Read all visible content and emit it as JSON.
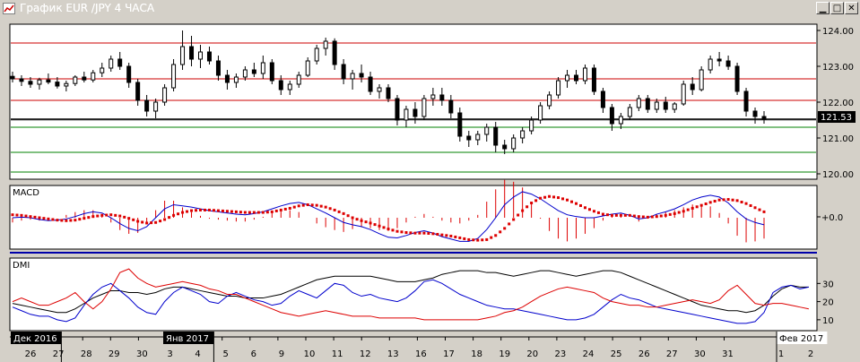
{
  "window": {
    "title": "График EUR /JPY  4 ЧАСА",
    "buttons": [
      "minimize",
      "maximize",
      "close"
    ]
  },
  "chart_data": [
    {
      "panel": "price",
      "type": "candlestick",
      "y_ticks": [
        "124.00",
        "123.00",
        "122.00",
        "121.00",
        "120.00"
      ],
      "ylim": [
        119.9,
        124.1
      ],
      "last_price_label": "121.53",
      "last_price": 121.53,
      "horizontal_lines": {
        "red": [
          123.65,
          122.65,
          122.05
        ],
        "black": [
          121.53
        ],
        "green": [
          121.3,
          120.6,
          120.05
        ]
      },
      "ohlc": [
        [
          122.72,
          122.85,
          122.55,
          122.65
        ],
        [
          122.65,
          122.75,
          122.45,
          122.58
        ],
        [
          122.58,
          122.7,
          122.4,
          122.5
        ],
        [
          122.5,
          122.68,
          122.35,
          122.62
        ],
        [
          122.62,
          122.8,
          122.5,
          122.56
        ],
        [
          122.56,
          122.7,
          122.38,
          122.45
        ],
        [
          122.45,
          122.6,
          122.3,
          122.52
        ],
        [
          122.52,
          122.75,
          122.45,
          122.7
        ],
        [
          122.7,
          122.85,
          122.55,
          122.62
        ],
        [
          122.62,
          122.9,
          122.55,
          122.82
        ],
        [
          122.82,
          123.1,
          122.7,
          122.95
        ],
        [
          122.95,
          123.3,
          122.85,
          123.2
        ],
        [
          123.2,
          123.4,
          122.9,
          123.0
        ],
        [
          123.0,
          123.1,
          122.4,
          122.55
        ],
        [
          122.55,
          122.65,
          121.9,
          122.05
        ],
        [
          122.05,
          122.2,
          121.6,
          121.75
        ],
        [
          121.75,
          122.1,
          121.55,
          122.0
        ],
        [
          122.0,
          122.5,
          121.9,
          122.4
        ],
        [
          122.4,
          123.2,
          122.3,
          123.05
        ],
        [
          123.05,
          124.0,
          122.9,
          123.55
        ],
        [
          123.55,
          123.85,
          123.0,
          123.2
        ],
        [
          123.2,
          123.6,
          122.95,
          123.4
        ],
        [
          123.4,
          123.55,
          123.05,
          123.15
        ],
        [
          123.15,
          123.3,
          122.6,
          122.75
        ],
        [
          122.75,
          122.9,
          122.35,
          122.55
        ],
        [
          122.55,
          122.8,
          122.4,
          122.7
        ],
        [
          122.7,
          123.0,
          122.6,
          122.9
        ],
        [
          122.9,
          123.1,
          122.7,
          122.8
        ],
        [
          122.8,
          123.3,
          122.65,
          123.1
        ],
        [
          123.1,
          123.2,
          122.5,
          122.6
        ],
        [
          122.6,
          122.75,
          122.2,
          122.35
        ],
        [
          122.35,
          122.6,
          122.2,
          122.5
        ],
        [
          122.5,
          122.85,
          122.4,
          122.75
        ],
        [
          122.75,
          123.25,
          122.7,
          123.15
        ],
        [
          123.15,
          123.6,
          123.05,
          123.5
        ],
        [
          123.5,
          123.8,
          123.3,
          123.7
        ],
        [
          123.7,
          123.78,
          122.9,
          123.05
        ],
        [
          123.05,
          123.2,
          122.5,
          122.65
        ],
        [
          122.65,
          122.9,
          122.35,
          122.8
        ],
        [
          122.8,
          123.05,
          122.55,
          122.7
        ],
        [
          122.7,
          122.85,
          122.2,
          122.3
        ],
        [
          122.3,
          122.5,
          122.1,
          122.4
        ],
        [
          122.4,
          122.5,
          122.0,
          122.1
        ],
        [
          122.1,
          122.2,
          121.35,
          121.5
        ],
        [
          121.5,
          121.9,
          121.3,
          121.8
        ],
        [
          121.8,
          122.0,
          121.4,
          121.6
        ],
        [
          121.6,
          122.2,
          121.5,
          122.1
        ],
        [
          122.1,
          122.4,
          121.9,
          122.2
        ],
        [
          122.2,
          122.4,
          121.9,
          122.05
        ],
        [
          122.05,
          122.2,
          121.55,
          121.7
        ],
        [
          121.7,
          121.85,
          120.9,
          121.05
        ],
        [
          121.05,
          121.2,
          120.75,
          120.95
        ],
        [
          120.95,
          121.2,
          120.8,
          121.1
        ],
        [
          121.1,
          121.4,
          120.9,
          121.3
        ],
        [
          121.3,
          121.45,
          120.6,
          120.8
        ],
        [
          120.8,
          120.95,
          120.55,
          120.7
        ],
        [
          120.7,
          121.1,
          120.6,
          121.0
        ],
        [
          121.0,
          121.3,
          120.85,
          121.2
        ],
        [
          121.2,
          121.6,
          121.1,
          121.5
        ],
        [
          121.5,
          122.0,
          121.4,
          121.9
        ],
        [
          121.9,
          122.3,
          121.8,
          122.2
        ],
        [
          122.2,
          122.7,
          122.1,
          122.6
        ],
        [
          122.6,
          122.9,
          122.4,
          122.75
        ],
        [
          122.75,
          122.9,
          122.5,
          122.6
        ],
        [
          122.6,
          123.05,
          122.5,
          122.95
        ],
        [
          122.95,
          123.05,
          122.2,
          122.3
        ],
        [
          122.3,
          122.4,
          121.7,
          121.85
        ],
        [
          121.85,
          121.95,
          121.2,
          121.4
        ],
        [
          121.4,
          121.7,
          121.25,
          121.6
        ],
        [
          121.6,
          121.95,
          121.5,
          121.85
        ],
        [
          121.85,
          122.2,
          121.75,
          122.1
        ],
        [
          122.1,
          122.2,
          121.7,
          121.8
        ],
        [
          121.8,
          122.1,
          121.7,
          122.0
        ],
        [
          122.0,
          122.15,
          121.7,
          121.8
        ],
        [
          121.8,
          122.0,
          121.7,
          121.95
        ],
        [
          121.95,
          122.6,
          121.9,
          122.5
        ],
        [
          122.5,
          122.7,
          122.2,
          122.35
        ],
        [
          122.35,
          123.0,
          122.3,
          122.9
        ],
        [
          122.9,
          123.3,
          122.8,
          123.2
        ],
        [
          123.2,
          123.4,
          123.0,
          123.15
        ],
        [
          123.15,
          123.3,
          122.9,
          123.0
        ],
        [
          123.0,
          123.1,
          122.2,
          122.3
        ],
        [
          122.3,
          122.4,
          121.6,
          121.75
        ],
        [
          121.75,
          121.85,
          121.4,
          121.6
        ],
        [
          121.6,
          121.75,
          121.4,
          121.53
        ]
      ]
    },
    {
      "panel": "macd",
      "type": "line+histogram",
      "label": "MACD",
      "zero_label": "+0.0",
      "ylim": [
        -0.5,
        0.5
      ],
      "macd": [
        0.0,
        0.01,
        0.0,
        -0.03,
        -0.05,
        -0.04,
        -0.02,
        0.02,
        0.07,
        0.1,
        0.08,
        0.0,
        -0.1,
        -0.18,
        -0.22,
        -0.15,
        0.0,
        0.15,
        0.22,
        0.2,
        0.18,
        0.15,
        0.12,
        0.1,
        0.08,
        0.06,
        0.05,
        0.07,
        0.1,
        0.15,
        0.2,
        0.24,
        0.26,
        0.22,
        0.15,
        0.08,
        0.0,
        -0.08,
        -0.12,
        -0.15,
        -0.2,
        -0.27,
        -0.33,
        -0.34,
        -0.3,
        -0.25,
        -0.22,
        -0.26,
        -0.32,
        -0.36,
        -0.4,
        -0.4,
        -0.35,
        -0.2,
        0.0,
        0.22,
        0.35,
        0.44,
        0.4,
        0.32,
        0.22,
        0.12,
        0.05,
        0.02,
        0.0,
        0.0,
        0.03,
        0.06,
        0.08,
        0.04,
        -0.02,
        0.0,
        0.06,
        0.1,
        0.15,
        0.22,
        0.3,
        0.35,
        0.38,
        0.35,
        0.25,
        0.1,
        -0.02,
        -0.08,
        -0.12
      ],
      "signal": [
        0.05,
        0.04,
        0.02,
        0.0,
        -0.02,
        -0.04,
        -0.05,
        -0.04,
        -0.01,
        0.02,
        0.04,
        0.05,
        0.03,
        -0.01,
        -0.06,
        -0.09,
        -0.08,
        -0.03,
        0.04,
        0.09,
        0.12,
        0.13,
        0.13,
        0.12,
        0.11,
        0.1,
        0.09,
        0.09,
        0.09,
        0.1,
        0.13,
        0.16,
        0.2,
        0.22,
        0.21,
        0.18,
        0.13,
        0.07,
        0.0,
        -0.05,
        -0.09,
        -0.14,
        -0.19,
        -0.23,
        -0.25,
        -0.26,
        -0.26,
        -0.27,
        -0.29,
        -0.31,
        -0.34,
        -0.37,
        -0.38,
        -0.37,
        -0.3,
        -0.18,
        -0.03,
        0.12,
        0.25,
        0.33,
        0.36,
        0.34,
        0.3,
        0.24,
        0.17,
        0.11,
        0.06,
        0.04,
        0.04,
        0.04,
        0.02,
        0.01,
        0.02,
        0.04,
        0.07,
        0.11,
        0.16,
        0.21,
        0.26,
        0.3,
        0.31,
        0.29,
        0.24,
        0.17,
        0.1
      ]
    },
    {
      "panel": "dmi",
      "type": "line",
      "label": "DMI",
      "y_ticks": [
        "30",
        "20",
        "10"
      ],
      "ylim": [
        5,
        43
      ],
      "series": [
        {
          "name": "",
          "color": "#000000",
          "values": [
            19,
            18,
            17,
            16,
            15,
            14,
            14,
            16,
            19,
            22,
            24,
            26,
            26,
            25,
            25,
            24,
            25,
            27,
            28,
            28,
            27,
            26,
            25,
            24,
            23,
            23,
            22,
            22,
            22,
            23,
            24,
            26,
            28,
            30,
            32,
            33,
            34,
            34,
            34,
            34,
            34,
            33,
            32,
            31,
            31,
            31,
            32,
            33,
            35,
            36,
            37,
            37,
            37,
            36,
            36,
            35,
            34,
            35,
            36,
            37,
            37,
            36,
            35,
            34,
            35,
            36,
            37,
            37,
            36,
            34,
            32,
            30,
            28,
            26,
            24,
            22,
            20,
            18,
            17,
            16,
            15,
            15,
            14,
            15,
            18,
            23,
            27,
            29,
            28,
            28
          ]
        },
        {
          "name": "",
          "color": "#0000cc",
          "values": [
            17,
            15,
            13,
            12,
            12,
            10,
            9,
            11,
            18,
            24,
            28,
            30,
            26,
            22,
            17,
            14,
            13,
            20,
            25,
            28,
            26,
            24,
            20,
            19,
            23,
            25,
            23,
            21,
            20,
            18,
            19,
            23,
            26,
            24,
            22,
            26,
            30,
            29,
            25,
            23,
            24,
            22,
            21,
            20,
            22,
            26,
            31,
            32,
            30,
            27,
            24,
            22,
            20,
            18,
            17,
            16,
            16,
            15,
            14,
            13,
            12,
            11,
            10,
            10,
            11,
            13,
            17,
            21,
            24,
            22,
            21,
            19,
            17,
            16,
            15,
            14,
            13,
            12,
            11,
            10,
            9,
            8,
            8,
            9,
            14,
            25,
            28,
            29,
            27,
            28
          ]
        },
        {
          "name": "",
          "color": "#dd0000",
          "values": [
            20,
            22,
            20,
            18,
            18,
            20,
            22,
            25,
            20,
            16,
            20,
            27,
            36,
            38,
            33,
            30,
            28,
            29,
            30,
            31,
            30,
            29,
            27,
            26,
            24,
            24,
            22,
            20,
            18,
            16,
            14,
            13,
            12,
            13,
            14,
            15,
            14,
            13,
            12,
            12,
            12,
            11,
            11,
            11,
            11,
            11,
            10,
            10,
            10,
            10,
            10,
            10,
            10,
            11,
            12,
            14,
            15,
            17,
            20,
            23,
            25,
            27,
            28,
            27,
            26,
            25,
            22,
            20,
            19,
            18,
            18,
            17,
            17,
            18,
            19,
            20,
            21,
            20,
            19,
            21,
            26,
            29,
            24,
            19,
            18,
            19,
            19,
            18,
            17,
            16
          ]
        }
      ]
    }
  ],
  "time_axis": {
    "date_labels": [
      "26",
      "27",
      "28",
      "29",
      "30",
      "3",
      "4",
      "5",
      "6",
      "9",
      "10",
      "11",
      "12",
      "13",
      "16",
      "17",
      "18",
      "19",
      "20",
      "23",
      "24",
      "25",
      "26",
      "27",
      "30",
      "31",
      "1",
      "2"
    ],
    "period_labels": [
      "Дек 2016",
      "Янв 2017",
      "Фев 2017"
    ]
  },
  "colors": {
    "background": "#ffffff",
    "frame": "#d4d0c8",
    "candle": "#000000",
    "macd_line": "#0000cc",
    "signal_dots": "#dd0000",
    "histogram": "#dd0000",
    "level_red": "#cc0000",
    "level_green": "#008000"
  }
}
